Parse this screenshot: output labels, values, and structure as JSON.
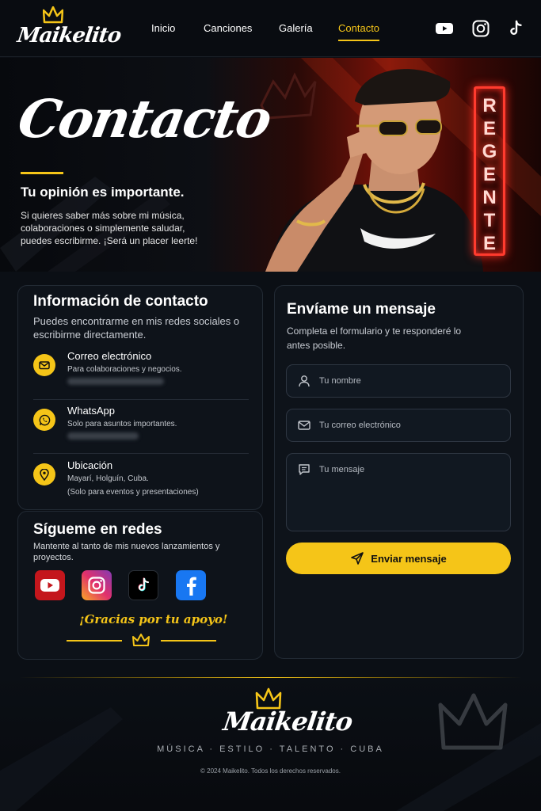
{
  "brand": {
    "name": "Maikelito"
  },
  "nav": {
    "links": [
      "Inicio",
      "Canciones",
      "Galería",
      "Contacto"
    ],
    "active": "Contacto",
    "social_icons": [
      "youtube-icon",
      "instagram-icon",
      "tiktok-icon"
    ]
  },
  "hero": {
    "title": "Contacto",
    "subtitle": "Tu opinión es importante.",
    "text": "Si quieres saber más sobre mi música, colaboraciones o simplemente saludar, puedes escribirme. ¡Será un placer leerte!",
    "neon_sign": [
      "R",
      "E",
      "G",
      "E",
      "N",
      "T",
      "E"
    ]
  },
  "contact_info": {
    "title": "Información de contacto",
    "subtitle": "Puedes encontrarme en mis redes sociales o escribirme directamente.",
    "items": [
      {
        "icon": "mail-icon",
        "title": "Correo electrónico",
        "desc": "Para colaboraciones y negocios."
      },
      {
        "icon": "whatsapp-icon",
        "title": "WhatsApp",
        "desc": "Solo para asuntos importantes."
      },
      {
        "icon": "location-pin-icon",
        "title": "Ubicación",
        "desc": "Mayarí, Holguín, Cuba.",
        "desc2": "(Solo para eventos y presentaciones)"
      }
    ]
  },
  "social": {
    "title": "Sígueme en redes",
    "subtitle": "Mantente al tanto de mis nuevos lanzamientos y proyectos.",
    "icons": [
      "youtube-icon",
      "instagram-icon",
      "tiktok-icon",
      "facebook-icon"
    ],
    "thanks": "¡Gracias por tu apoyo!"
  },
  "form": {
    "title": "Envíame un mensaje",
    "subtitle": "Completa el formulario y te responderé lo antes posible.",
    "name_placeholder": "Tu nombre",
    "email_placeholder": "Tu correo electrónico",
    "message_placeholder": "Tu mensaje",
    "submit_label": "Enviar mensaje"
  },
  "footer": {
    "tagline": "MÚSICA · ESTILO · TALENTO · CUBA",
    "copyright": "© 2024 Maikelito. Todos los derechos reservados."
  },
  "colors": {
    "accent": "#f5c518",
    "background": "#0b0f15",
    "card": "#0e131a",
    "neon": "#ff3b2e"
  }
}
